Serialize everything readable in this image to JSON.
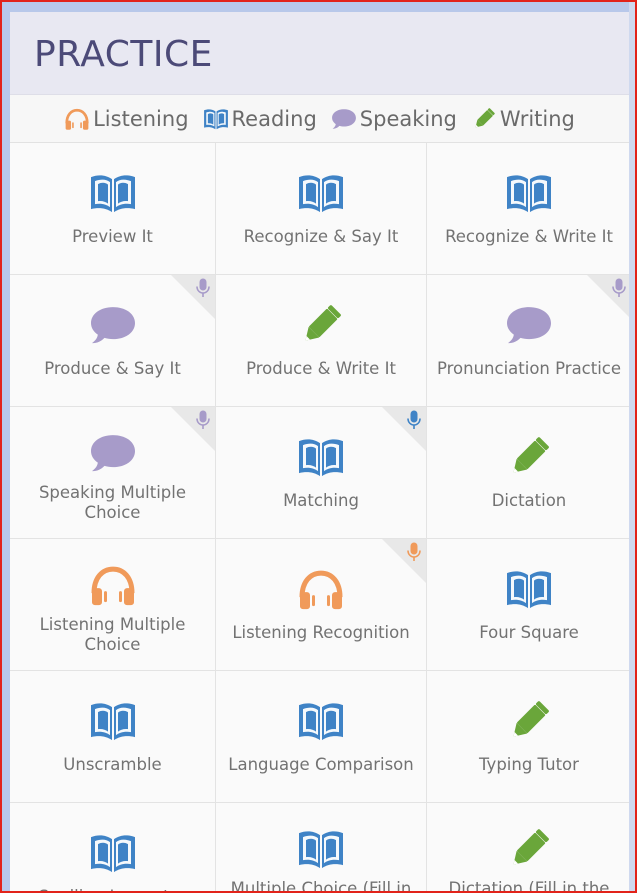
{
  "header": {
    "title": "PRACTICE"
  },
  "legend": [
    {
      "label": "Listening",
      "icon": "headphones-icon"
    },
    {
      "label": "Reading",
      "icon": "book-icon"
    },
    {
      "label": "Speaking",
      "icon": "speech-bubble-icon"
    },
    {
      "label": "Writing",
      "icon": "pencil-icon"
    }
  ],
  "colors": {
    "listening": "#f09a5a",
    "reading": "#3f83c6",
    "speaking": "#a79bc9",
    "writing": "#6aa63a",
    "mic_speaking": "#a79bc9",
    "mic_reading": "#3f83c6",
    "mic_listening": "#f09a5a"
  },
  "activities": [
    {
      "label": "Preview It",
      "icon": "book-icon",
      "mic": ""
    },
    {
      "label": "Recognize & Say It",
      "icon": "book-icon",
      "mic": ""
    },
    {
      "label": "Recognize & Write It",
      "icon": "book-icon",
      "mic": ""
    },
    {
      "label": "Produce & Say It",
      "icon": "speech-bubble-icon",
      "mic": "speaking"
    },
    {
      "label": "Produce & Write It",
      "icon": "pencil-icon",
      "mic": ""
    },
    {
      "label": "Pronunciation Practice",
      "icon": "speech-bubble-icon",
      "mic": "speaking"
    },
    {
      "label": "Speaking Multiple Choice",
      "icon": "speech-bubble-icon",
      "mic": "speaking"
    },
    {
      "label": "Matching",
      "icon": "book-icon",
      "mic": "reading"
    },
    {
      "label": "Dictation",
      "icon": "pencil-icon",
      "mic": ""
    },
    {
      "label": "Listening Multiple Choice",
      "icon": "headphones-icon",
      "mic": ""
    },
    {
      "label": "Listening Recognition",
      "icon": "headphones-icon",
      "mic": "listening"
    },
    {
      "label": "Four Square",
      "icon": "book-icon",
      "mic": ""
    },
    {
      "label": "Unscramble",
      "icon": "book-icon",
      "mic": ""
    },
    {
      "label": "Language Comparison",
      "icon": "book-icon",
      "mic": ""
    },
    {
      "label": "Typing Tutor",
      "icon": "pencil-icon",
      "mic": ""
    },
    {
      "label": "Spelling Inspector",
      "icon": "book-icon",
      "mic": ""
    },
    {
      "label": "Multiple Choice (Fill in the Blank)",
      "icon": "book-icon",
      "mic": ""
    },
    {
      "label": "Dictation (Fill in the Blank)",
      "icon": "pencil-icon",
      "mic": ""
    }
  ]
}
